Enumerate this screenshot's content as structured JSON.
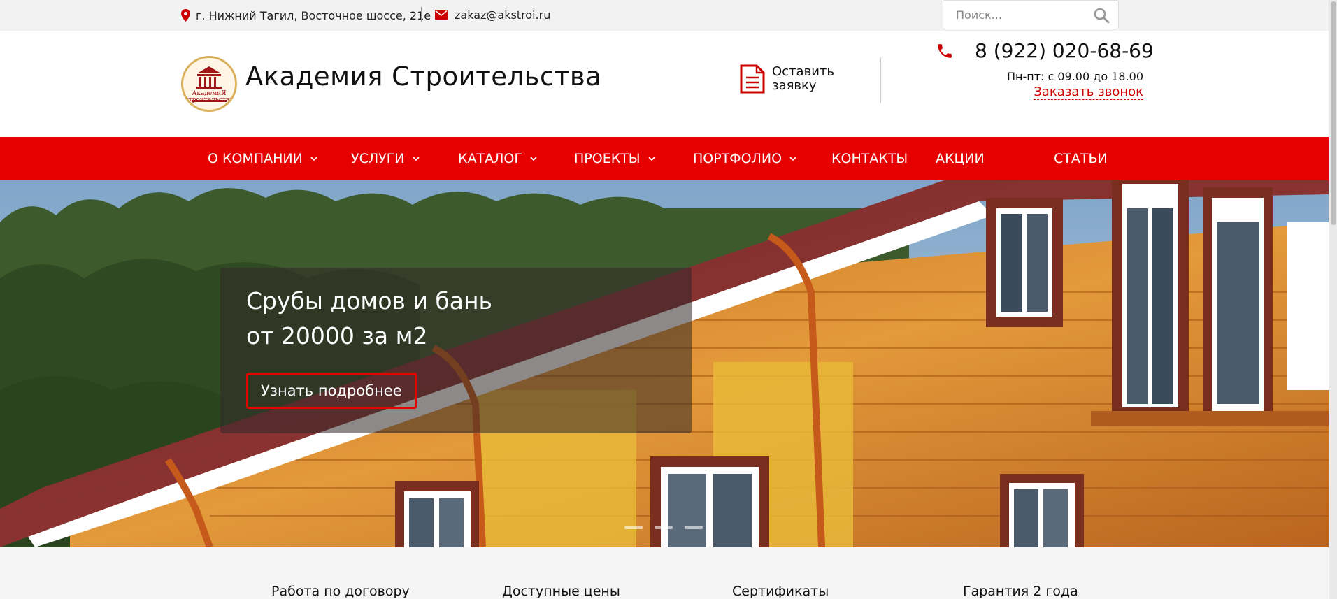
{
  "topbar": {
    "address": "г. Нижний Тагил, Восточное шоссе, 21е",
    "email": "zakaz@akstroi.ru",
    "search_placeholder": "Поиск..."
  },
  "header": {
    "logo_text": "АкадемиЯ строительства",
    "brand": "Академия Строительства",
    "request_label": "Оставить заявку",
    "phone": "8 (922) 020-68-69",
    "hours": "Пн-пт: с 09.00 до 18.00",
    "callback": "Заказать звонок"
  },
  "nav": {
    "items": [
      {
        "label": "О КОМПАНИИ",
        "has_dropdown": true
      },
      {
        "label": "УСЛУГИ",
        "has_dropdown": true
      },
      {
        "label": "КАТАЛОГ",
        "has_dropdown": true
      },
      {
        "label": "ПРОЕКТЫ",
        "has_dropdown": true
      },
      {
        "label": "ПОРТФОЛИО",
        "has_dropdown": true
      },
      {
        "label": "КОНТАКТЫ",
        "has_dropdown": false
      },
      {
        "label": "АКЦИИ",
        "has_dropdown": false
      },
      {
        "label": "СТАТЬИ",
        "has_dropdown": false
      }
    ]
  },
  "hero": {
    "title_line1": "Срубы домов и бань",
    "title_line2": "от 20000 за м2",
    "button": "Узнать подробнее",
    "slides": 3
  },
  "features": [
    "Работа по договору",
    "Доступные цены",
    "Сертификаты",
    "Гарантия 2 года"
  ],
  "colors": {
    "accent": "#e60000",
    "topbar_bg": "#f2f2f2",
    "link": "#cc0000"
  },
  "icons": {
    "address": "map-pin-icon",
    "email": "envelope-icon",
    "search": "search-icon",
    "request": "document-icon",
    "phone": "phone-icon",
    "dropdown": "chevron-down-icon"
  }
}
